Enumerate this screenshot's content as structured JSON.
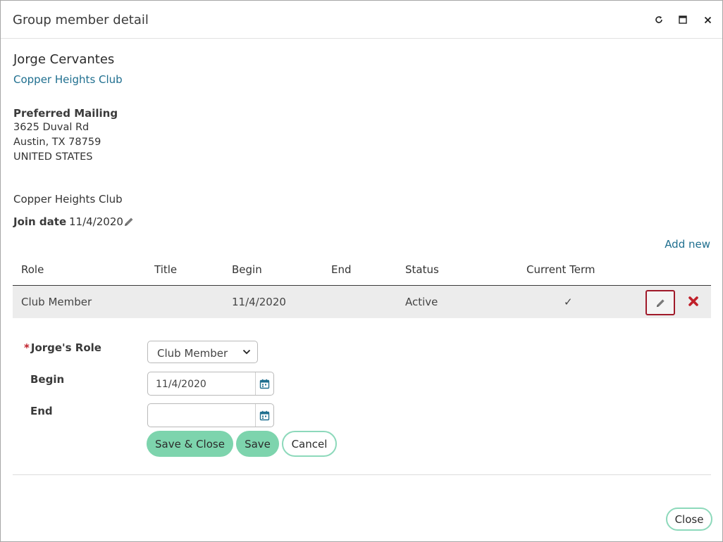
{
  "dialog": {
    "title": "Group member detail",
    "controls": [
      "refresh-icon",
      "maximize-icon",
      "close-icon"
    ]
  },
  "member": {
    "name": "Jorge Cervantes",
    "club_link": "Copper Heights Club"
  },
  "mailing": {
    "label": "Preferred Mailing",
    "line1": "3625 Duval Rd",
    "line2": "Austin, TX 78759",
    "line3": "UNITED STATES"
  },
  "group": {
    "name": "Copper Heights Club",
    "join_label": "Join date",
    "join_value": "11/4/2020"
  },
  "table": {
    "add_new": "Add new",
    "headers": {
      "role": "Role",
      "title": "Title",
      "begin": "Begin",
      "end": "End",
      "status": "Status",
      "current_term": "Current Term"
    },
    "rows": [
      {
        "role": "Club Member",
        "title": "",
        "begin": "11/4/2020",
        "end": "",
        "status": "Active",
        "current_term": "✓"
      }
    ]
  },
  "form": {
    "required_mark": "*",
    "role_label": "Jorge's Role",
    "role_value": "Club Member",
    "begin_label": "Begin",
    "begin_value": "11/4/2020",
    "end_label": "End",
    "end_value": "",
    "save_close": "Save & Close",
    "save": "Save",
    "cancel": "Cancel"
  },
  "footer": {
    "close": "Close"
  },
  "colors": {
    "link": "#1f6f8f",
    "primary_button": "#7dd4ad",
    "outline_button_border": "#8dd9bb",
    "delete_icon": "#c0202a",
    "edit_highlight_border": "#a01a2a",
    "row_background": "#ececec",
    "calendar_icon": "#1f6f8f"
  }
}
